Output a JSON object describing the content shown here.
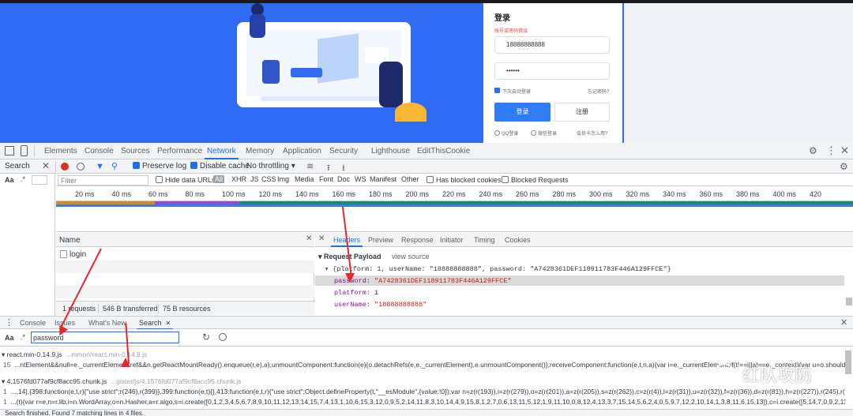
{
  "login": {
    "title": "登录",
    "warning": "账号或密码错误",
    "phone_value": "18888888888",
    "password_value": "••••••",
    "auto_login_label": "下次自动登录",
    "forgot_label": "忘记密码?",
    "login_button": "登录",
    "register_button": "注册",
    "qq_label": "QQ登录",
    "wechat_label": "微信登录",
    "member_label": "会员卡怎么用?"
  },
  "devtools": {
    "main_tabs": [
      "Elements",
      "Console",
      "Sources",
      "Performance",
      "Network",
      "Memory",
      "Application",
      "Security",
      "Lighthouse",
      "EditThisCookie"
    ],
    "selected_tab": "Network",
    "search_label": "Search",
    "preserve_log": "Preserve log",
    "disable_cache": "Disable cache",
    "throttling": "No throttling",
    "filter_placeholder": "Filter",
    "hide_data_urls": "Hide data URLs",
    "filter_types": [
      "All",
      "XHR",
      "JS",
      "CSS",
      "Img",
      "Media",
      "Font",
      "Doc",
      "WS",
      "Manifest",
      "Other"
    ],
    "has_blocked_cookies": "Has blocked cookies",
    "blocked_requests": "Blocked Requests",
    "timeline_ticks": [
      "20 ms",
      "40 ms",
      "60 ms",
      "80 ms",
      "100 ms",
      "120 ms",
      "140 ms",
      "160 ms",
      "180 ms",
      "200 ms",
      "220 ms",
      "240 ms",
      "260 ms",
      "280 ms",
      "300 ms",
      "320 ms",
      "340 ms",
      "360 ms",
      "380 ms",
      "400 ms",
      "420"
    ],
    "name_header": "Name",
    "request_name": "login",
    "summary": {
      "requests": "1 requests",
      "transferred": "546 B transferred",
      "resources": "75 B resources"
    },
    "detail_tabs": [
      "Headers",
      "Preview",
      "Response",
      "Initiator",
      "Timing",
      "Cookies"
    ],
    "payload_title": "Request Payload",
    "view_source": "view source",
    "payload_summary": "{platform: 1, userName: \"18888888888\", password: \"A7428361DEF118911783F446A129FFCE\"}",
    "payload_fields": [
      {
        "key": "password",
        "value": "\"A7428361DEF118911783F446A129FFCE\""
      },
      {
        "key": "platform",
        "value": "1"
      },
      {
        "key": "userName",
        "value": "\"18888888888\""
      }
    ],
    "drawer_tabs": [
      "Console",
      "Issues",
      "What's New",
      "Search"
    ],
    "search_query": "password",
    "results": [
      {
        "file": "react.min-0.14.9.js",
        "path": "...mmon/react.min-0.14.9.js",
        "line_num": "15",
        "line": "...ntElement&&null=e._currentElement.ref&&n.getReactMountReady().enqueue(r,e),a),unmountComponent:function(e){o.detachRefs(e,e._currentElement),e.unmountComponent()},receiveComponent:function(e,t,n,a){var i=e._currentElement;if(t!==i||a!==e._context){var u=o.should..."
      },
      {
        "file": "4.1576fd077af9cf8acc95.chunk.js",
        "path": "...gister/js/4.1576fd077af9cf8acc95.chunk.js",
        "line_num": "1",
        "line": "...,14],{398:function(e,t,r){\"use strict\";r(246),r(399)},399:function(e,t){},413:function(e,t,r){\"use strict\";Object.defineProperty(t,\"__esModule\",{value:!0});var n=z(r(193)),i=z(r(279)),o=z(r(201)),a=z(r(205)),s=z(r(262)),c=z(r(4)),l=z(r(31)),u=z(r(32)),f=z(r(36)),d=z(r(81)),h=z(r(227)),r(245),r(290),r(...",
        "line_num2": "1",
        "line2": "...(t){var r=e,n=r.lib,i=n.WordArray,o=n.Hasher,a=r.algo,s=i.create([0,1,2,3,4,5,6,7,8,9,10,11,12,13,14,15,7,4,13,1,10,6,15,3,12,0,9,5,2,14,11,8,3,10,14,4,9,15,8,1,2,7,0,6,13,11,5,12,1,9,11,10,0,8,12,4,13,3,7,15,14,5,6,2,4,0,5,9,7,12,2,10,14,1,3,8,11,6,15,13]),c=i.create([5,14,7,0,9,2,11,4,13,6,15,8,..."
      }
    ],
    "status": "Search finished.  Found 7 matching lines in 4 files."
  },
  "watermark": "红队攻防"
}
